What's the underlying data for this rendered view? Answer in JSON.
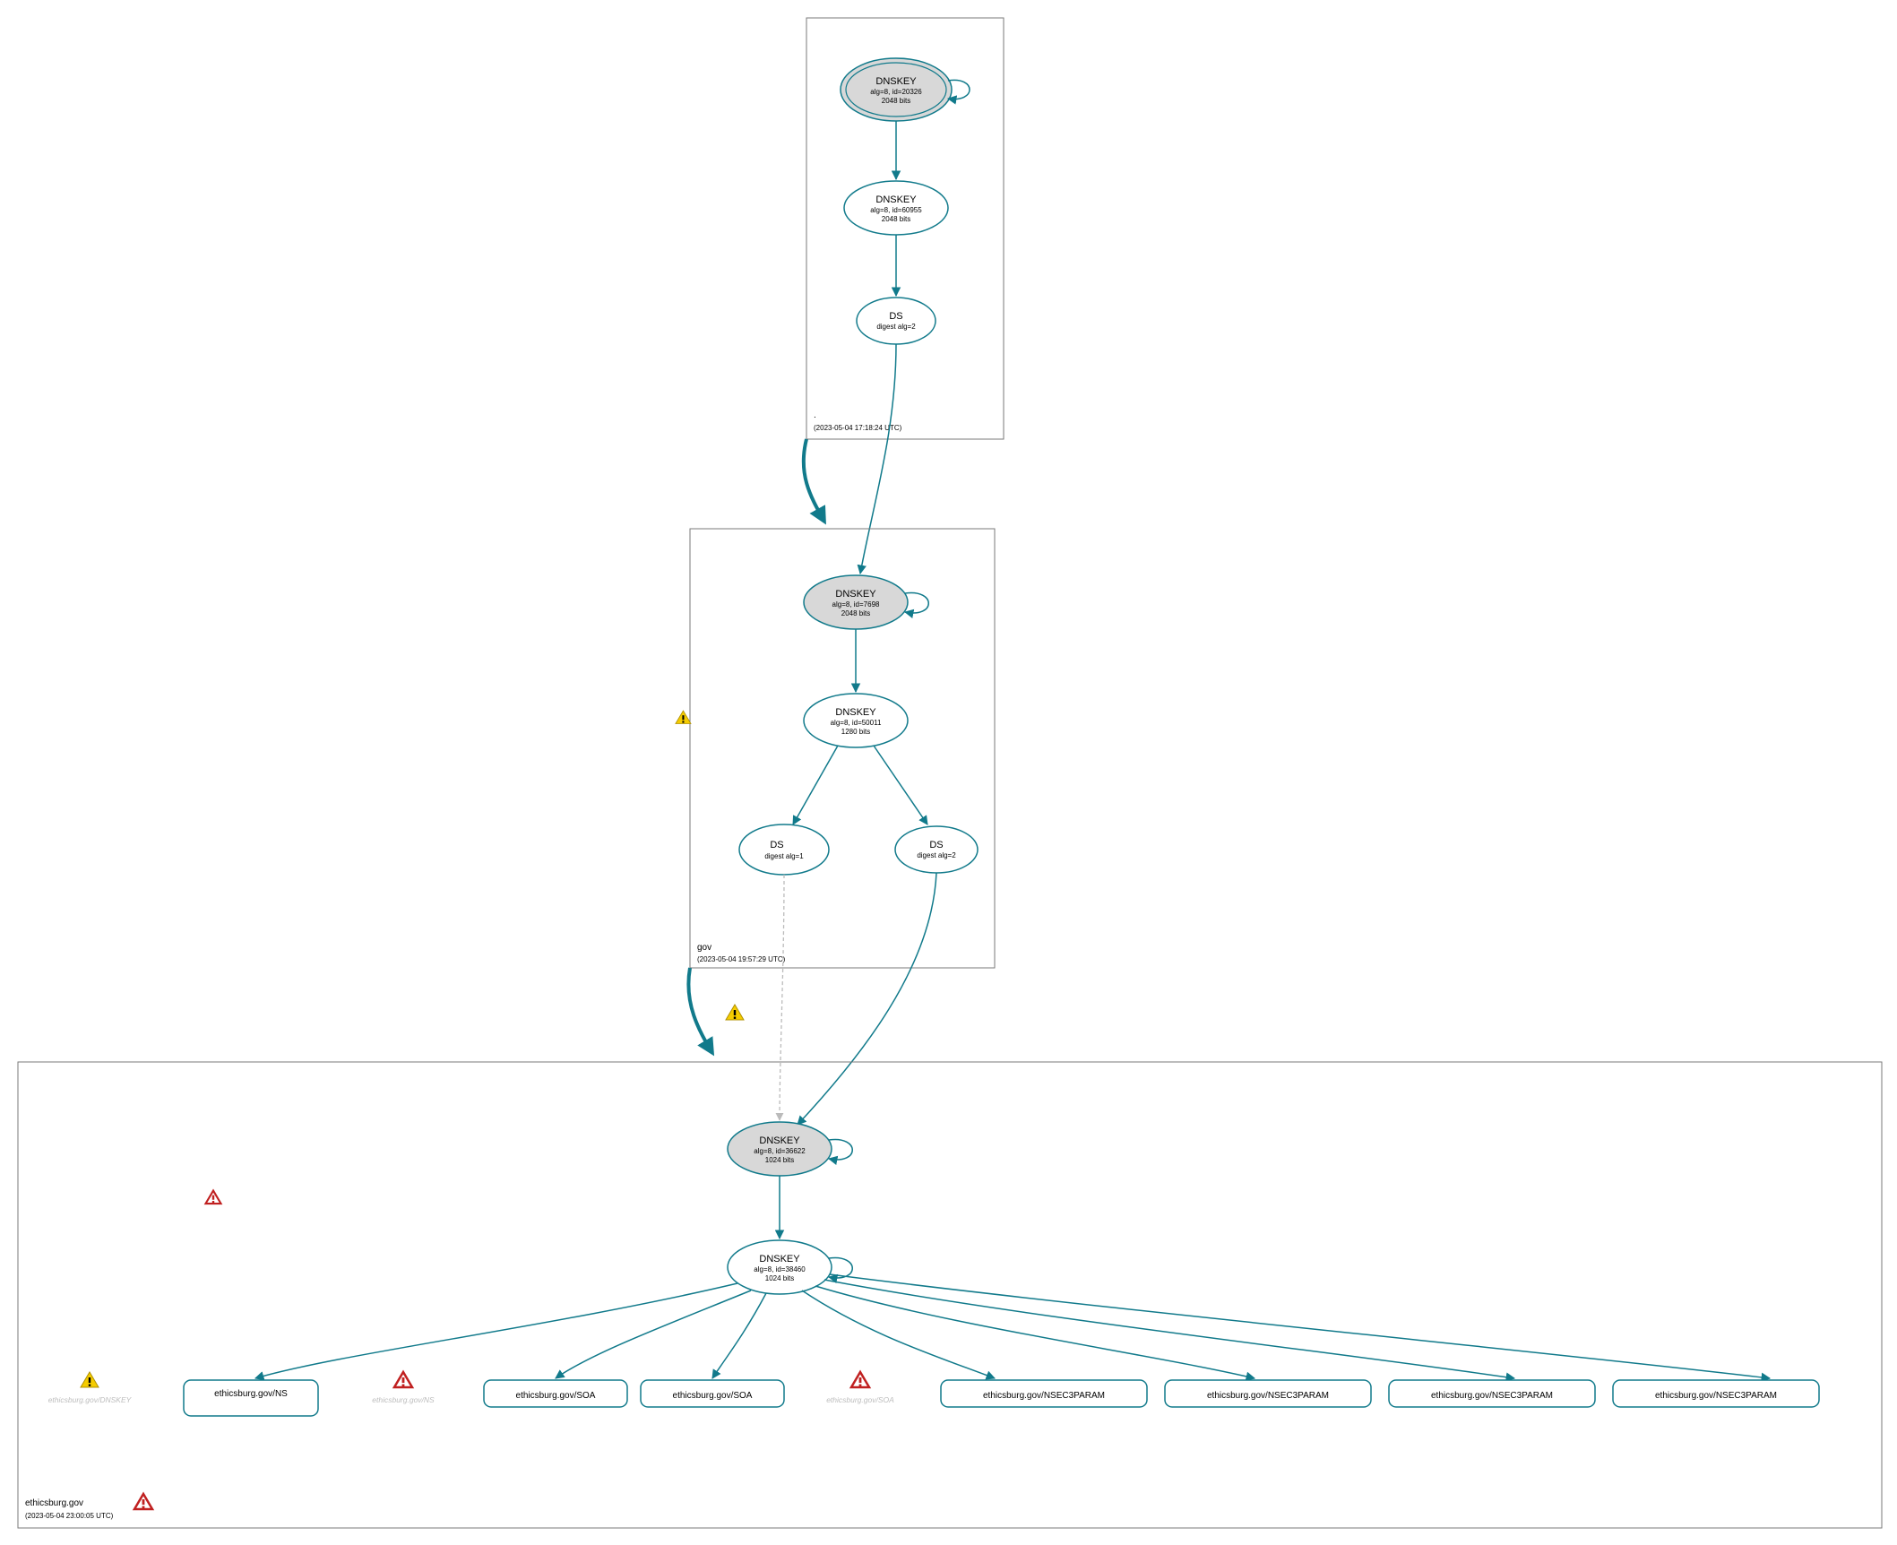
{
  "colors": {
    "teal": "#117a8b",
    "gray_fill": "#d8d8d8",
    "box_stroke": "#7a7a7a",
    "faded": "#bdbdbd",
    "warn_yellow": "#f5cc00",
    "warn_red": "#c02020"
  },
  "zones": {
    "root": {
      "label": ".",
      "timestamp": "(2023-05-04 17:18:24 UTC)",
      "nodes": {
        "dnskey_ksk": {
          "title": "DNSKEY",
          "line1": "alg=8, id=20326",
          "line2": "2048 bits"
        },
        "dnskey_zsk": {
          "title": "DNSKEY",
          "line1": "alg=8, id=60955",
          "line2": "2048 bits"
        },
        "ds": {
          "title": "DS",
          "line1": "digest alg=2"
        }
      }
    },
    "gov": {
      "label": "gov",
      "timestamp": "(2023-05-04 19:57:29 UTC)",
      "nodes": {
        "dnskey_ksk": {
          "title": "DNSKEY",
          "line1": "alg=8, id=7698",
          "line2": "2048 bits"
        },
        "dnskey_zsk": {
          "title": "DNSKEY",
          "line1": "alg=8, id=50011",
          "line2": "1280 bits"
        },
        "ds1": {
          "title": "DS",
          "line1": "digest alg=1"
        },
        "ds2": {
          "title": "DS",
          "line1": "digest alg=2"
        }
      }
    },
    "domain": {
      "label": "ethicsburg.gov",
      "timestamp": "(2023-05-04 23:00:05 UTC)",
      "nodes": {
        "dnskey_ksk": {
          "title": "DNSKEY",
          "line1": "alg=8, id=36622",
          "line2": "1024 bits"
        },
        "dnskey_zsk": {
          "title": "DNSKEY",
          "line1": "alg=8, id=38460",
          "line2": "1024 bits"
        }
      }
    }
  },
  "leaves": {
    "faded_dnskey": "ethicsburg.gov/DNSKEY",
    "ns": "ethicsburg.gov/NS",
    "faded_ns": "ethicsburg.gov/NS",
    "soa1": "ethicsburg.gov/SOA",
    "soa2": "ethicsburg.gov/SOA",
    "faded_soa": "ethicsburg.gov/SOA",
    "n3p1": "ethicsburg.gov/NSEC3PARAM",
    "n3p2": "ethicsburg.gov/NSEC3PARAM",
    "n3p3": "ethicsburg.gov/NSEC3PARAM",
    "n3p4": "ethicsburg.gov/NSEC3PARAM"
  }
}
